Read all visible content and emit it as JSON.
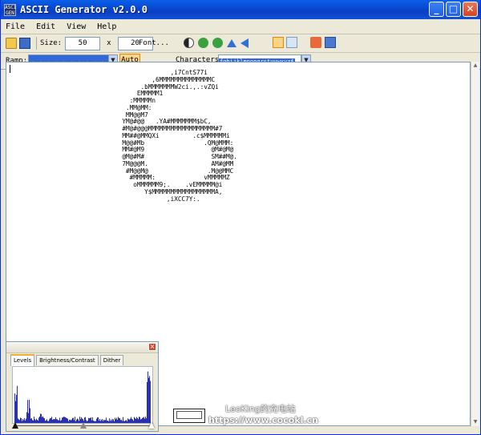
{
  "window": {
    "title": "ASCII Generator v2.0.0",
    "app_icon_text": "ASCII GEN",
    "minimize_label": "_",
    "maximize_label": "□",
    "close_label": "✕"
  },
  "menu": [
    {
      "id": "file",
      "label": "File"
    },
    {
      "id": "edit",
      "label": "Edit"
    },
    {
      "id": "view",
      "label": "View"
    },
    {
      "id": "help",
      "label": "Help"
    }
  ],
  "toolbar": {
    "size_label": "Size:",
    "width_value": "50",
    "times_label": "x",
    "height_value": "20",
    "font_button_label": "Font..."
  },
  "ramp": {
    "label": "Ramp:",
    "value": ". . . . . . . . . . . . .",
    "auto_label": "Auto",
    "characters_label": "Characters:",
    "characters_value": "fghijklmnopqrstuvwxyz$"
  },
  "ascii_art": "                    ,i7CntS77i\n               ,6MMMMMMMMMMMMMMC\n            .bMMMMMMMW2ci.,.:vZQi\n           EMMMMM1\n         :MMMMMn\n        .MM@MM:\n        MM@@M7\n       YM@#@@   .YA#MMMMMMM$bC,\n       #M@#@@@MMMMMMMMMMMMMMMMMM#7\n       MM##@MMQXi         .c$MMMMMMi\n       M@@#Mb                .QM@MMM:\n       MM#@M9                  @M#@M@\n       @M@#M#                  SM##M@.\n       7M@@@M.                 AM#@MM\n        #M@@M@                .M@@MMC\n         #MMMMM:             vMMMMMZ\n          oMMMMMM9;.    .vEMMMMM@i\n             Y$MMMMMMMMMMMMMMMMMA,\n                   ,iXCC7Y:.",
  "levels_panel": {
    "tabs": [
      {
        "id": "levels",
        "label": "Levels"
      },
      {
        "id": "brightness",
        "label": "Brightness/Contrast"
      },
      {
        "id": "dither",
        "label": "Dither"
      }
    ],
    "close_label": "×",
    "histogram_color": "#2a30b0"
  },
  "watermark": {
    "line1": "LeoKing的充电站",
    "line2": "https://www.cocokl.cn"
  }
}
